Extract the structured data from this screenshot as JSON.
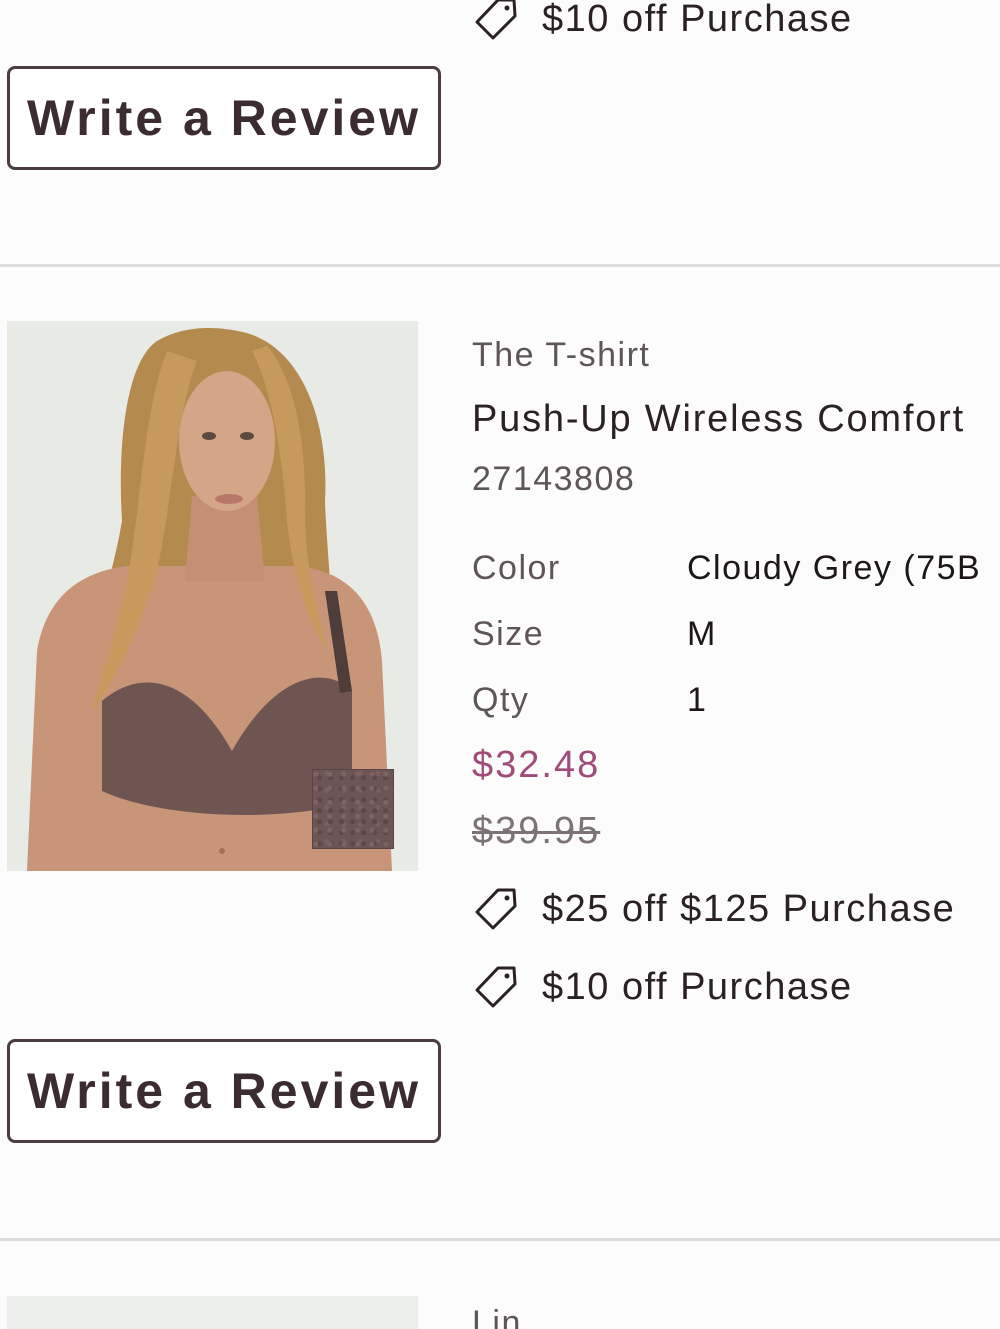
{
  "top_item": {
    "promos": [
      {
        "icon": "price-tag-icon",
        "text": "$10 off Purchase"
      }
    ],
    "review_button_label": "Write a Review"
  },
  "item": {
    "image_alt": "Model wearing push-up wireless bra",
    "swatch_color": "#6d5555",
    "collection": "The T-shirt",
    "name": "Push-Up Wireless Comfort",
    "sku": "27143808",
    "attributes": [
      {
        "label": "Color",
        "value": "Cloudy Grey (75B"
      },
      {
        "label": "Size",
        "value": "M"
      },
      {
        "label": "Qty",
        "value": "1"
      }
    ],
    "sale_price": "$32.48",
    "original_price": "$39.95",
    "promos": [
      {
        "icon": "price-tag-icon",
        "text": "$25 off $125 Purchase"
      },
      {
        "icon": "price-tag-icon",
        "text": "$10 off Purchase"
      }
    ],
    "review_button_label": "Write a Review"
  },
  "next_item": {
    "collection_partial": "Lin"
  },
  "colors": {
    "sale_price": "#a04b79",
    "button_border": "#4a3c41",
    "divider": "#dcdcdc"
  }
}
